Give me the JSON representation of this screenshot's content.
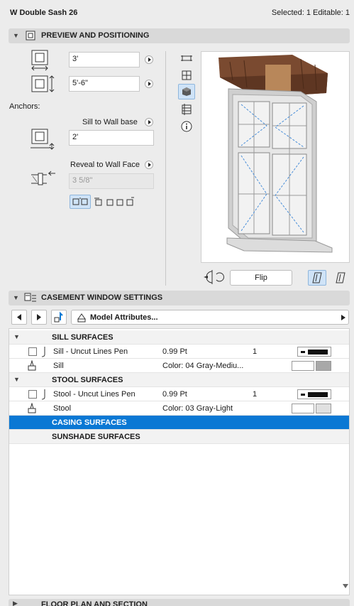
{
  "header": {
    "title": "W Double Sash 26",
    "status": "Selected: 1 Editable: 1"
  },
  "preview_section": {
    "title": "PREVIEW AND POSITIONING",
    "width_value": "3'",
    "height_value": "5'-6\"",
    "anchors_label": "Anchors:",
    "sill_anchor_label": "Sill to Wall base",
    "sill_value": "2'",
    "reveal_label": "Reveal to Wall Face",
    "reveal_value": "3 5/8\"",
    "flip_label": "Flip"
  },
  "casement_section": {
    "title": "CASEMENT WINDOW SETTINGS",
    "attributes_label": "Model Attributes..."
  },
  "list": {
    "groups": [
      {
        "title": "SILL SURFACES",
        "rows": [
          {
            "name": "Sill - Uncut Lines Pen",
            "value": "0.99 Pt",
            "extra": "1",
            "kind": "pen"
          },
          {
            "name": "Sill",
            "value": "Color: 04 Gray-Mediu...",
            "kind": "surface",
            "swatch": "#a8a8a8"
          }
        ]
      },
      {
        "title": "STOOL SURFACES",
        "rows": [
          {
            "name": "Stool - Uncut Lines Pen",
            "value": "0.99 Pt",
            "extra": "1",
            "kind": "pen"
          },
          {
            "name": "Stool",
            "value": "Color: 03 Gray-Light",
            "kind": "surface",
            "swatch": "#e0e0e0"
          }
        ]
      }
    ],
    "casing_title": "CASING SURFACES",
    "sunshade_title": "SUNSHADE SURFACES"
  },
  "floor_section": {
    "title": "FLOOR PLAN AND SECTION"
  },
  "colors": {
    "accent": "#0a78d4",
    "header_bg": "#d9d9d9",
    "active_icon_bg": "#cfe3f7"
  }
}
